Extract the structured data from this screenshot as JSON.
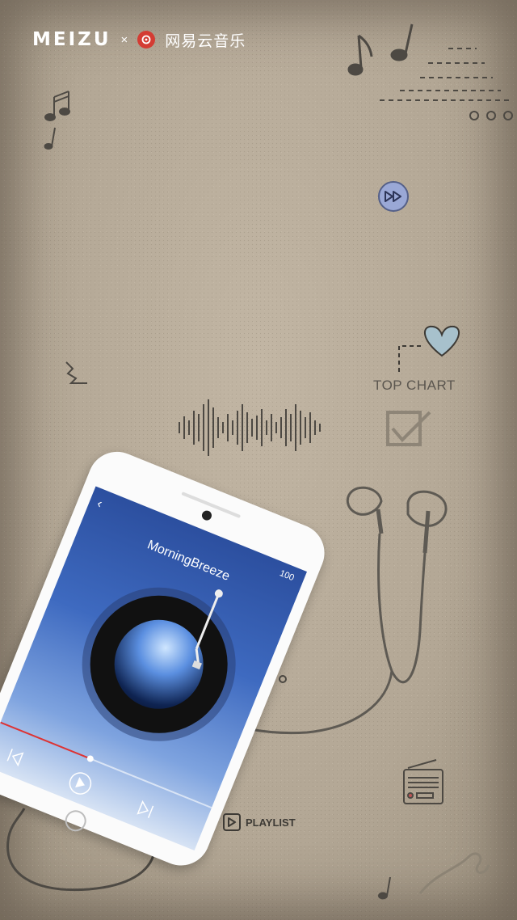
{
  "brand": {
    "meizu": "MEIZU",
    "separator": "×",
    "netease": "网易云音乐"
  },
  "labels": {
    "top_chart": "TOP CHART",
    "playlist": "PLAYLIST"
  },
  "phone": {
    "song_title": "MorningBreeze",
    "battery": "100"
  },
  "colors": {
    "accent_blue": "#3e6ac0",
    "netease_red": "#d43c33",
    "heart": "#a7c1cc",
    "ink": "#5b564f"
  }
}
